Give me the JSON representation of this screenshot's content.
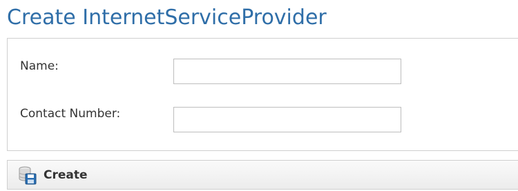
{
  "page": {
    "title": "Create InternetServiceProvider"
  },
  "form": {
    "fields": [
      {
        "label": "Name:",
        "value": "",
        "placeholder": ""
      },
      {
        "label": "Contact Number:",
        "value": "",
        "placeholder": ""
      }
    ]
  },
  "actions": {
    "create_label": "Create",
    "create_icon": "database-save-icon"
  },
  "colors": {
    "title": "#2f6ea8",
    "icon_blue": "#2a6fb3"
  }
}
